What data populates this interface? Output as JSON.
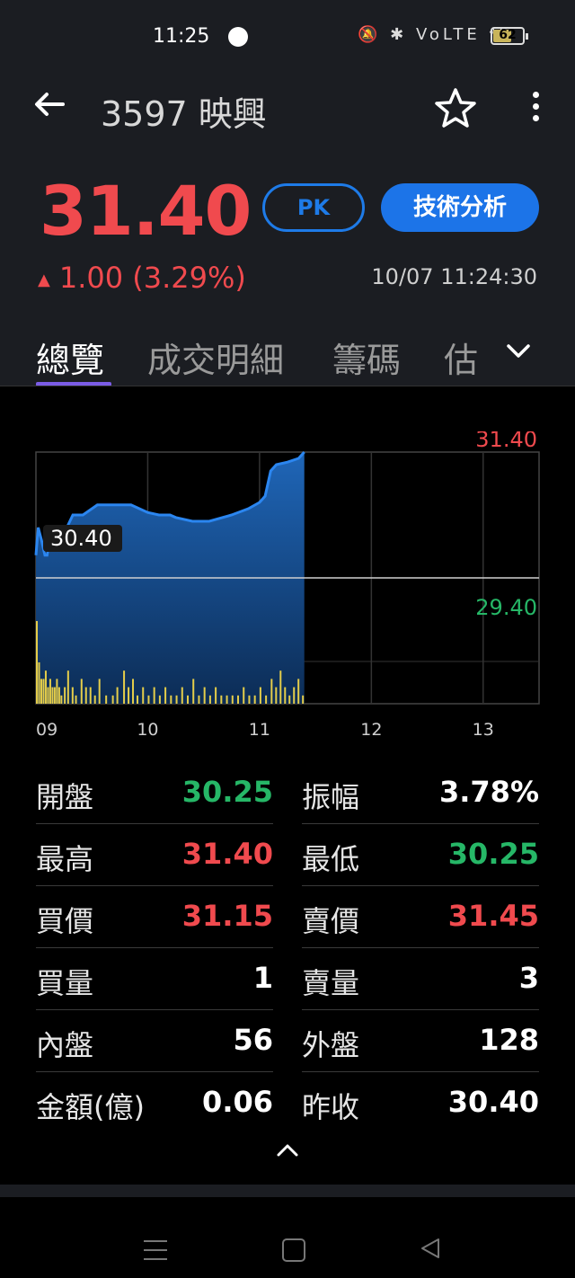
{
  "status_bar": {
    "time": "11:25",
    "icons": "🔕 ✱ VoLTE ⁴ᴳ",
    "battery": "62",
    "battery_level": 0.62
  },
  "header": {
    "title": "3597 映興"
  },
  "quote": {
    "price": "31.40",
    "change": "1.00 (3.29%)",
    "datetime": "10/07 11:24:30",
    "pk_label": "PK",
    "ta_label": "技術分析"
  },
  "tabs": [
    {
      "label": "總覽"
    },
    {
      "label": "成交明細"
    },
    {
      "label": "籌碼"
    },
    {
      "label": "估"
    }
  ],
  "chart_data": {
    "type": "area",
    "x_ticks": [
      "09",
      "10",
      "11",
      "12",
      "13"
    ],
    "y_labels": {
      "high": "31.40",
      "ref": "30.40",
      "low": "29.40"
    },
    "ylim": [
      29.4,
      31.4
    ],
    "reference": 30.4,
    "price_series": {
      "t": [
        9.0,
        9.02,
        9.05,
        9.08,
        9.1,
        9.13,
        9.17,
        9.2,
        9.25,
        9.33,
        9.42,
        9.55,
        9.67,
        9.85,
        10.0,
        10.1,
        10.2,
        10.25,
        10.4,
        10.55,
        10.75,
        10.9,
        11.0,
        11.05,
        11.1,
        11.15,
        11.25,
        11.35,
        11.4
      ],
      "v": [
        30.58,
        30.8,
        30.7,
        30.58,
        30.58,
        30.75,
        30.78,
        30.75,
        30.75,
        30.9,
        30.9,
        30.98,
        30.98,
        30.98,
        30.92,
        30.9,
        30.9,
        30.88,
        30.85,
        30.85,
        30.9,
        30.95,
        31.0,
        31.05,
        31.25,
        31.3,
        31.32,
        31.35,
        31.4
      ]
    },
    "volume_series": {
      "t": [
        9.0,
        9.02,
        9.04,
        9.06,
        9.08,
        9.1,
        9.12,
        9.14,
        9.16,
        9.18,
        9.2,
        9.22,
        9.25,
        9.28,
        9.32,
        9.35,
        9.4,
        9.44,
        9.48,
        9.52,
        9.56,
        9.62,
        9.68,
        9.72,
        9.78,
        9.82,
        9.86,
        9.9,
        9.95,
        10.0,
        10.05,
        10.1,
        10.15,
        10.2,
        10.25,
        10.3,
        10.35,
        10.4,
        10.45,
        10.5,
        10.55,
        10.6,
        10.65,
        10.7,
        10.75,
        10.8,
        10.85,
        10.9,
        10.95,
        11.0,
        11.05,
        11.1,
        11.14,
        11.18,
        11.22,
        11.26,
        11.3,
        11.34,
        11.38
      ],
      "v": [
        10,
        5,
        3,
        3,
        4,
        2,
        3,
        2,
        2,
        3,
        2,
        1,
        2,
        4,
        2,
        1,
        3,
        2,
        2,
        1,
        3,
        1,
        1,
        2,
        4,
        2,
        3,
        1,
        2,
        1,
        2,
        1,
        2,
        1,
        1,
        2,
        1,
        3,
        1,
        2,
        1,
        2,
        1,
        1,
        1,
        1,
        2,
        1,
        1,
        2,
        1,
        3,
        2,
        4,
        2,
        1,
        2,
        3,
        1
      ]
    }
  },
  "stats": [
    [
      {
        "label": "開盤",
        "value": "30.25",
        "color": "down"
      },
      {
        "label": "振幅",
        "value": "3.78%",
        "color": "neutral"
      }
    ],
    [
      {
        "label": "最高",
        "value": "31.40",
        "color": "up"
      },
      {
        "label": "最低",
        "value": "30.25",
        "color": "down"
      }
    ],
    [
      {
        "label": "買價",
        "value": "31.15",
        "color": "up"
      },
      {
        "label": "賣價",
        "value": "31.45",
        "color": "up"
      }
    ],
    [
      {
        "label": "買量",
        "value": "1",
        "color": "neutral"
      },
      {
        "label": "賣量",
        "value": "3",
        "color": "neutral"
      }
    ],
    [
      {
        "label": "內盤",
        "value": "56",
        "color": "neutral"
      },
      {
        "label": "外盤",
        "value": "128",
        "color": "neutral"
      }
    ],
    [
      {
        "label": "金額(億)",
        "value": "0.06",
        "color": "neutral"
      },
      {
        "label": "昨收",
        "value": "30.40",
        "color": "neutral"
      }
    ]
  ],
  "colors": {
    "up": "#f04a4e",
    "down": "#26b767",
    "accent": "#1c74e8",
    "area": "#1f5ea8",
    "line": "#2b86f0",
    "volume": "#e4cd4a"
  }
}
